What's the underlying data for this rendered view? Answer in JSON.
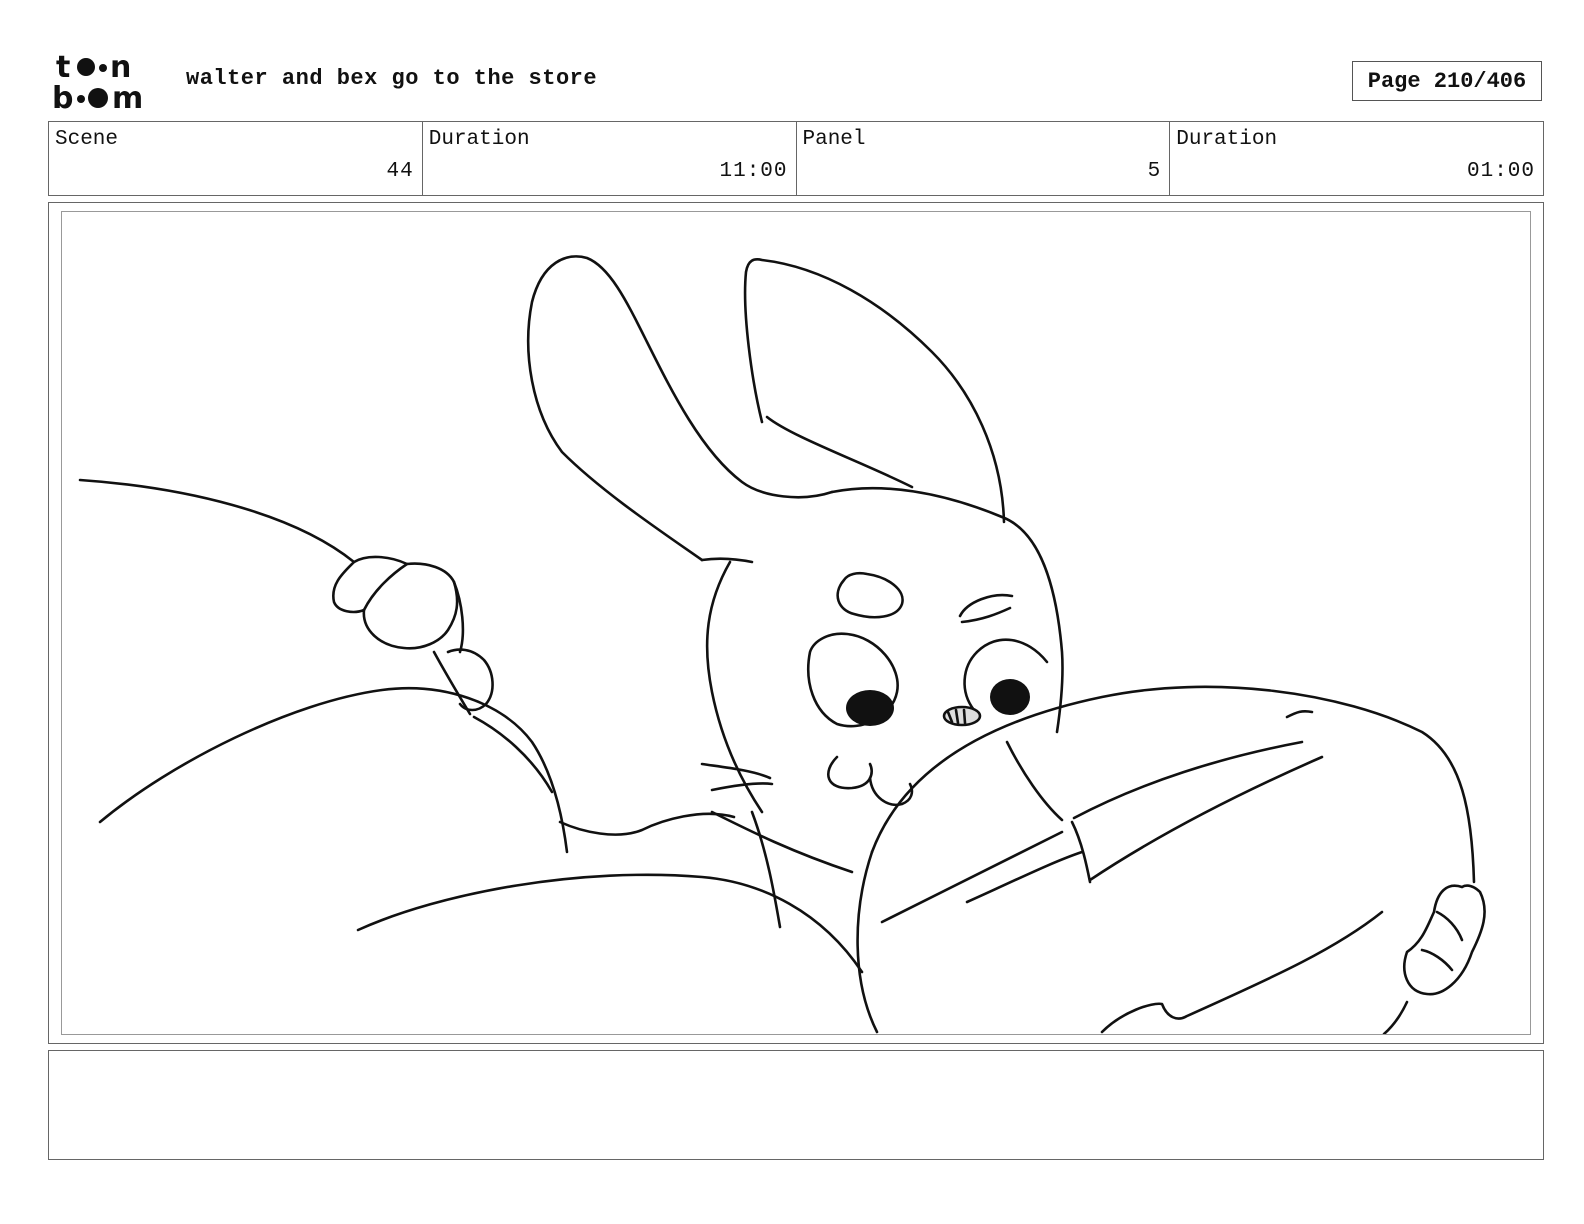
{
  "header": {
    "logo": {
      "line1": "t  n",
      "line2": "b  m",
      "icon": "toonboom-logo"
    },
    "project_title": "walter and bex go to the store",
    "page_label": "Page 210/406"
  },
  "info": {
    "scene": {
      "label": "Scene",
      "value": "44"
    },
    "scene_duration": {
      "label": "Duration",
      "value": "11:00"
    },
    "panel": {
      "label": "Panel",
      "value": "5"
    },
    "panel_duration": {
      "label": "Duration",
      "value": "01:00"
    }
  },
  "panel_image": {
    "icon": "storyboard-sketch-bunny"
  },
  "notes": {
    "text": ""
  },
  "colors": {
    "ink": "#111111",
    "border": "#666666",
    "background": "#ffffff"
  }
}
